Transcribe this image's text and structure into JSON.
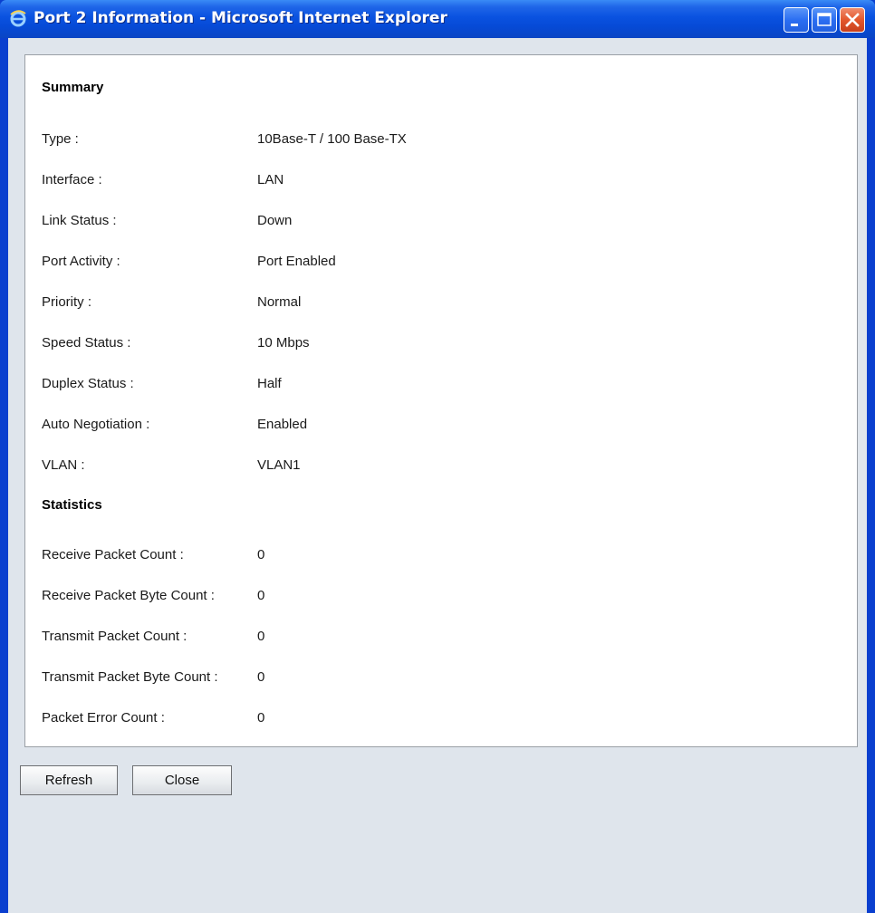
{
  "window": {
    "title": "Port 2 Information - Microsoft Internet Explorer"
  },
  "summary": {
    "heading": "Summary",
    "rows": [
      {
        "label": "Type :",
        "value": "10Base-T / 100 Base-TX"
      },
      {
        "label": "Interface :",
        "value": "LAN"
      },
      {
        "label": "Link Status :",
        "value": "Down"
      },
      {
        "label": "Port Activity :",
        "value": "Port Enabled"
      },
      {
        "label": "Priority :",
        "value": "Normal"
      },
      {
        "label": "Speed Status :",
        "value": "10 Mbps"
      },
      {
        "label": "Duplex Status :",
        "value": "Half"
      },
      {
        "label": "Auto Negotiation :",
        "value": "Enabled"
      },
      {
        "label": "VLAN :",
        "value": "VLAN1"
      }
    ]
  },
  "statistics": {
    "heading": "Statistics",
    "rows": [
      {
        "label": "Receive Packet Count :",
        "value": "0"
      },
      {
        "label": "Receive Packet Byte Count :",
        "value": "0"
      },
      {
        "label": "Transmit Packet Count :",
        "value": "0"
      },
      {
        "label": "Transmit Packet Byte Count :",
        "value": "0"
      },
      {
        "label": "Packet Error Count :",
        "value": "0"
      }
    ]
  },
  "buttons": {
    "refresh": "Refresh",
    "close": "Close"
  },
  "icons": {
    "app": "ie-icon",
    "minimize": "minimize-icon",
    "maximize": "maximize-icon",
    "close": "close-icon"
  },
  "colors": {
    "titlebar": "#0a52e0",
    "client": "#dfe5ec",
    "close_button": "#e3572c"
  }
}
